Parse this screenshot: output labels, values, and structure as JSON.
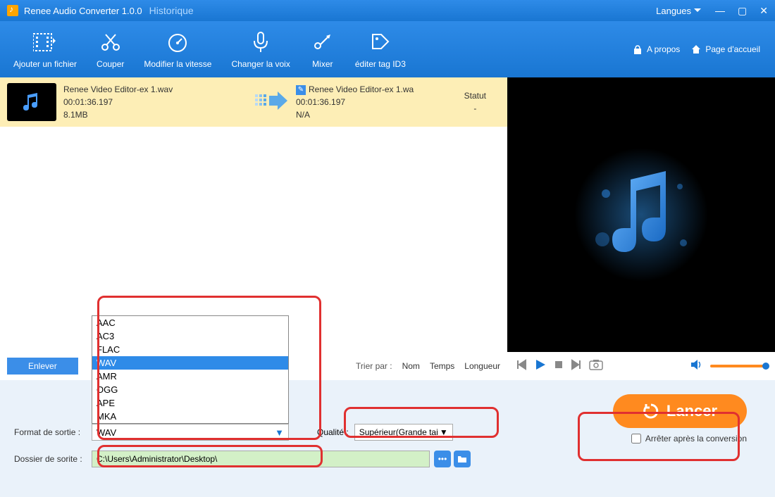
{
  "titlebar": {
    "title": "Renee Audio Converter 1.0.0",
    "history": "Historique",
    "languages": "Langues"
  },
  "toolbar": {
    "add_file": "Ajouter un fichier",
    "cut": "Couper",
    "speed": "Modifier la vitesse",
    "voice": "Changer la voix",
    "mix": "Mixer",
    "id3": "éditer tag ID3",
    "about": "A propos",
    "home": "Page d'accueil"
  },
  "file": {
    "src_name": "Renee Video Editor-ex 1.wav",
    "src_duration": "00:01:36.197",
    "src_size": "8.1MB",
    "out_name": "Renee Video Editor-ex 1.wa",
    "out_duration": "00:01:36.197",
    "out_size": "N/A",
    "status_label": "Statut",
    "status_value": "-"
  },
  "controls": {
    "remove": "Enlever",
    "sort_by": "Trier par :",
    "sort_name": "Nom",
    "sort_time": "Temps",
    "sort_length": "Longueur"
  },
  "bottom": {
    "format_label": "Format de sortie :",
    "format_value": "WAV",
    "format_options": [
      "AAC",
      "AC3",
      "FLAC",
      "WAV",
      "AMR",
      "OGG",
      "APE",
      "MKA"
    ],
    "format_selected_index": 3,
    "quality_label": "Qualité :",
    "quality_value": "Supérieur(Grande tai",
    "folder_label": "Dossier de sorite :",
    "folder_value": "C:\\Users\\Administrator\\Desktop\\",
    "launch": "Lancer",
    "stop_after": "Arrêter après la conversion"
  }
}
